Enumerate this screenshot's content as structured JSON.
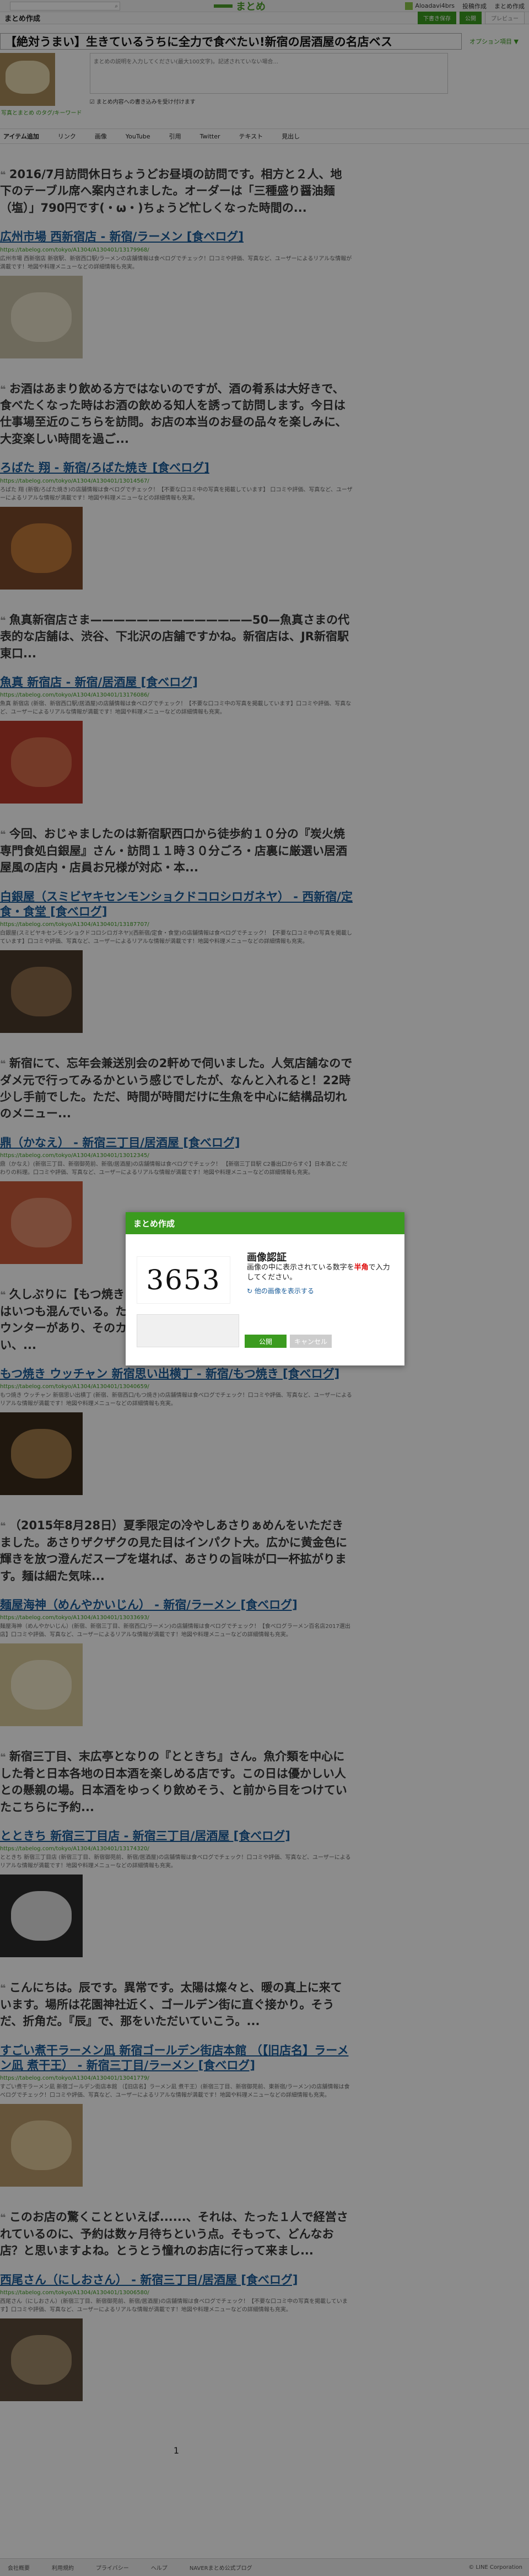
{
  "header": {
    "search_icon": "search-icon",
    "logo_text": "まとめ",
    "user_name": "Aloadavi4brs",
    "links": [
      "投稿作成",
      "まとめ作成"
    ]
  },
  "subbar": {
    "title": "まとめ作成",
    "btn_draft": "下書き保存",
    "btn_publish": "公開",
    "btn_preview": "プレビュー"
  },
  "editor": {
    "title_value": "【絶対うまい】生きているうちに全力で食べたい!新宿の居酒屋の名店ベス",
    "option_label": "オプション項目 ▼",
    "thumb_caption": "写真とまとめ のタグ/キーワード",
    "desc_placeholder": "まとめの説明を入力してください(最大100文字)。記述されていない場合...",
    "checkbox_label": "まとめ内容への書き込みを受け付けます"
  },
  "tabs": [
    "アイテム追加",
    "リンク",
    "画像",
    "YouTube",
    "引用",
    "Twitter",
    "テキスト",
    "見出し"
  ],
  "items": [
    {
      "quote": "2016/7月訪問休日ちょうどお昼頃の訪問です。相方と２人、地下のテーブル席へ案内されました。オーダーは「三種盛り醤油麺（塩）」790円です(・ω・)ちょうど忙しくなった時間の...",
      "title": "広州市場 西新宿店 - 新宿/ラーメン [食べログ]",
      "url": "https://tabelog.com/tokyo/A1304/A130401/13179968/",
      "desc": "広州市場 西新宿店 新宿駅、新宿西口駅/ラーメンの店舗情報は食べログでチェック！口コミや評価、写真など、ユーザーによるリアルな情報が満載です！地図や料理メニューなどの詳細情報も充実。"
    },
    {
      "quote": "お酒はあまり飲める方ではないのですが、酒の肴系は大好きで、食べたくなった時はお酒の飲める知人を誘って訪問します。今日は仕事場至近のこちらを訪問。お店の本当のお昼の品々を楽しみに、大変楽しい時間を過ご...",
      "title": "ろばた 翔 - 新宿/ろばた焼き [食べログ]",
      "url": "https://tabelog.com/tokyo/A1304/A130401/13014567/",
      "desc": "ろばた 翔 (新宿/ろばた焼き)の店舗情報は食べログでチェック！【不要な口コミ中の写真を掲載しています】 口コミや評価、写真など、ユーザーによるリアルな情報が満載です！地図や料理メニューなどの詳細情報も充実。"
    },
    {
      "quote": "魚真新宿店さま——————————————50—魚真さまの代表的な店舗は、渋谷、下北沢の店舗ですかね。新宿店は、JR新宿駅東口...",
      "title": "魚真 新宿店 - 新宿/居酒屋 [食べログ]",
      "url": "https://tabelog.com/tokyo/A1304/A130401/13176086/",
      "desc": "魚真 新宿店 (新宿、新宿西口駅/居酒屋)の店舗情報は食べログでチェック！【不要な口コミ中の写真を掲載しています】口コミや評価、写真など、ユーザーによるリアルな情報が満載です！地図や料理メニューなどの詳細情報も充実。"
    },
    {
      "quote": "今回、おじゃましたのは新宿駅西口から徒歩約１０分の『炭火焼専門食処白銀屋』さん・訪問１１時３０分ごろ・店裏に厳選い居酒屋風の店内・店員お兄様が対応・本...",
      "title": "白銀屋（スミビヤキセンモンショクドコロシロガネヤ） - 西新宿/定食・食堂 [食べログ]",
      "url": "https://tabelog.com/tokyo/A1304/A130401/13187707/",
      "desc": "白銀屋(スミビヤキセンモンショクドコロシロガネヤ)(西新宿/定食・食堂)の店舗情報は食べログでチェック！【不要な口コミ中の写真を掲載しています】口コミや評価、写真など、ユーザーによるリアルな情報が満載です！地図や料理メニューなどの詳細情報も充実。"
    },
    {
      "quote": "新宿にて、忘年会兼送別会の2軒めで伺いました。人気店舗なのでダメ元で行ってみるかという感じでしたが、なんと入れると！22時少し手前でした。ただ、時間が時間だけに生魚を中心に結構品切れのメニュー...",
      "title": "鼎（かなえ） - 新宿三丁目/居酒屋 [食べログ]",
      "url": "https://tabelog.com/tokyo/A1304/A130401/13012345/",
      "desc": "鼎（かなえ）(新宿三丁目、新宿御苑前、新宿/居酒屋)の店舗情報は食べログでチェック！ 【新宿三丁目駅 C2番出口からすぐ】日本酒とこだわりの料理。口コミや評価、写真など、ユーザーによるリアルな情報が満載です！地図や料理メニューなどの詳細情報も充実。"
    },
    {
      "quote": "久しぶりに【もつ焼き ウッチャン 新宿思い出横丁】...このお店はいつも混んでいる。ただ並ぶことはなくて...通りに面したL字カウンターがあり、そのカウンター席に座りました。もつ焼も美味しい、...",
      "title": "もつ焼き ウッチャン 新宿思い出横丁 - 新宿/もつ焼き [食べログ]",
      "url": "https://tabelog.com/tokyo/A1304/A130401/13040659/",
      "desc": "もつ焼き ウッチャン 新宿思い出横丁 (新宿、新宿西口/もつ焼き)の店舗情報は食べログでチェック！口コミや評価、写真など、ユーザーによるリアルな情報が満載です！地図や料理メニューなどの詳細情報も充実。"
    },
    {
      "quote": "（2015年8月28日）夏季限定の冷やしあさりぁめんをいただきました。あさりザクザクの見た目はインパクト大。広かに黄金色に輝きを放つ澄んだスープを堪れば、あさりの旨味が口一杯拡がります。麺は細た気味...",
      "title": "麺屋海神（めんやかいじん） - 新宿/ラーメン [食べログ]",
      "url": "https://tabelog.com/tokyo/A1304/A130401/13033693/",
      "desc": "麺屋海神（めんやかいじん）(新宿、新宿三丁目、新宿西口/ラーメン)の店舗情報は食べログでチェック！【食べログラーメン百名店2017選出店】口コミや評価、写真など、ユーザーによるリアルな情報が満載です！地図や料理メニューなどの詳細情報も充実。"
    },
    {
      "quote": "新宿三丁目、末広亭となりの『とときち』さん。魚介類を中心にした肴と日本各地の日本酒を楽しめる店です。この日は優かしい人との懸親の場。日本酒をゆっくり飲めそう、と前から目をつけていたこちらに予約...",
      "title": "とときち 新宿三丁目店 - 新宿三丁目/居酒屋 [食べログ]",
      "url": "https://tabelog.com/tokyo/A1304/A130401/13174320/",
      "desc": "とときち 新宿三丁目店 (新宿三丁目、新宿御苑前、新宿/居酒屋)の店舗情報は食べログでチェック！口コミや評価、写真など、ユーザーによるリアルな情報が満載です！地図や料理メニューなどの詳細情報も充実。"
    },
    {
      "quote": "こんにちは。辰です。異常です。太陽は燦々と、暖の真上に来ています。場所は花園神社近く、ゴールデン街に直ぐ接かり。そうだ、折角だ。『辰』で、那をいただいていこう。...",
      "title": "すごい煮干ラーメン凪 新宿ゴールデン街店本館 （【旧店名】ラーメン凪 煮干王） - 新宿三丁目/ラーメン [食べログ]",
      "url": "https://tabelog.com/tokyo/A1304/A130401/13041779/",
      "desc": "すごい煮干ラーメン凪 新宿ゴールデン街店本館 （【旧店名】ラーメン凪 煮干王）(新宿三丁目、新宿御苑前、東新宿/ラーメン)の店舗情報は食べログでチェック！口コミや評価、写真など、ユーザーによるリアルな情報が満載です！地図や料理メニューなどの詳細情報も充実。"
    },
    {
      "quote": "このお店の驚くことといえば......、それは、たった１人で経営されているのに、予約は数ヶ月待ちという点。そもって、どんなお店？と思いますよね。とうとう憧れのお店に行って来まし...",
      "title": "西尾さん（にしおさん） - 新宿三丁目/居酒屋 [食べログ]",
      "url": "https://tabelog.com/tokyo/A1304/A130401/13006580/",
      "desc": "西尾さん（にしおさん）(新宿三丁目、新宿御苑前、新宿/居酒屋)の店舗情報は食べログでチェック！【不要な口コミ中の写真を掲載しています】口コミや評価、写真など、ユーザーによるリアルな情報が満載です！地図や料理メニューなどの詳細情報も充実。"
    }
  ],
  "pager": "1",
  "footer": {
    "links": [
      "会社概要",
      "利用規約",
      "プライバシー",
      "ヘルプ",
      "NAVERまとめ公式ブログ"
    ],
    "copyright": "© LINE Corporation"
  },
  "modal": {
    "header": "まとめ作成",
    "captcha_text": "3653",
    "title": "画像認証",
    "text_pre": "画像の中に表示されている数字を",
    "text_red": "半角",
    "text_post": "で入力してください。",
    "refresh": "他の画像を表示する",
    "ok": "公開",
    "cancel": "キャンセル"
  },
  "colors": {
    "accent": "#3b9b1f",
    "link": "#1a5c99",
    "overlay": "rgba(0,0,0,0.45)"
  }
}
